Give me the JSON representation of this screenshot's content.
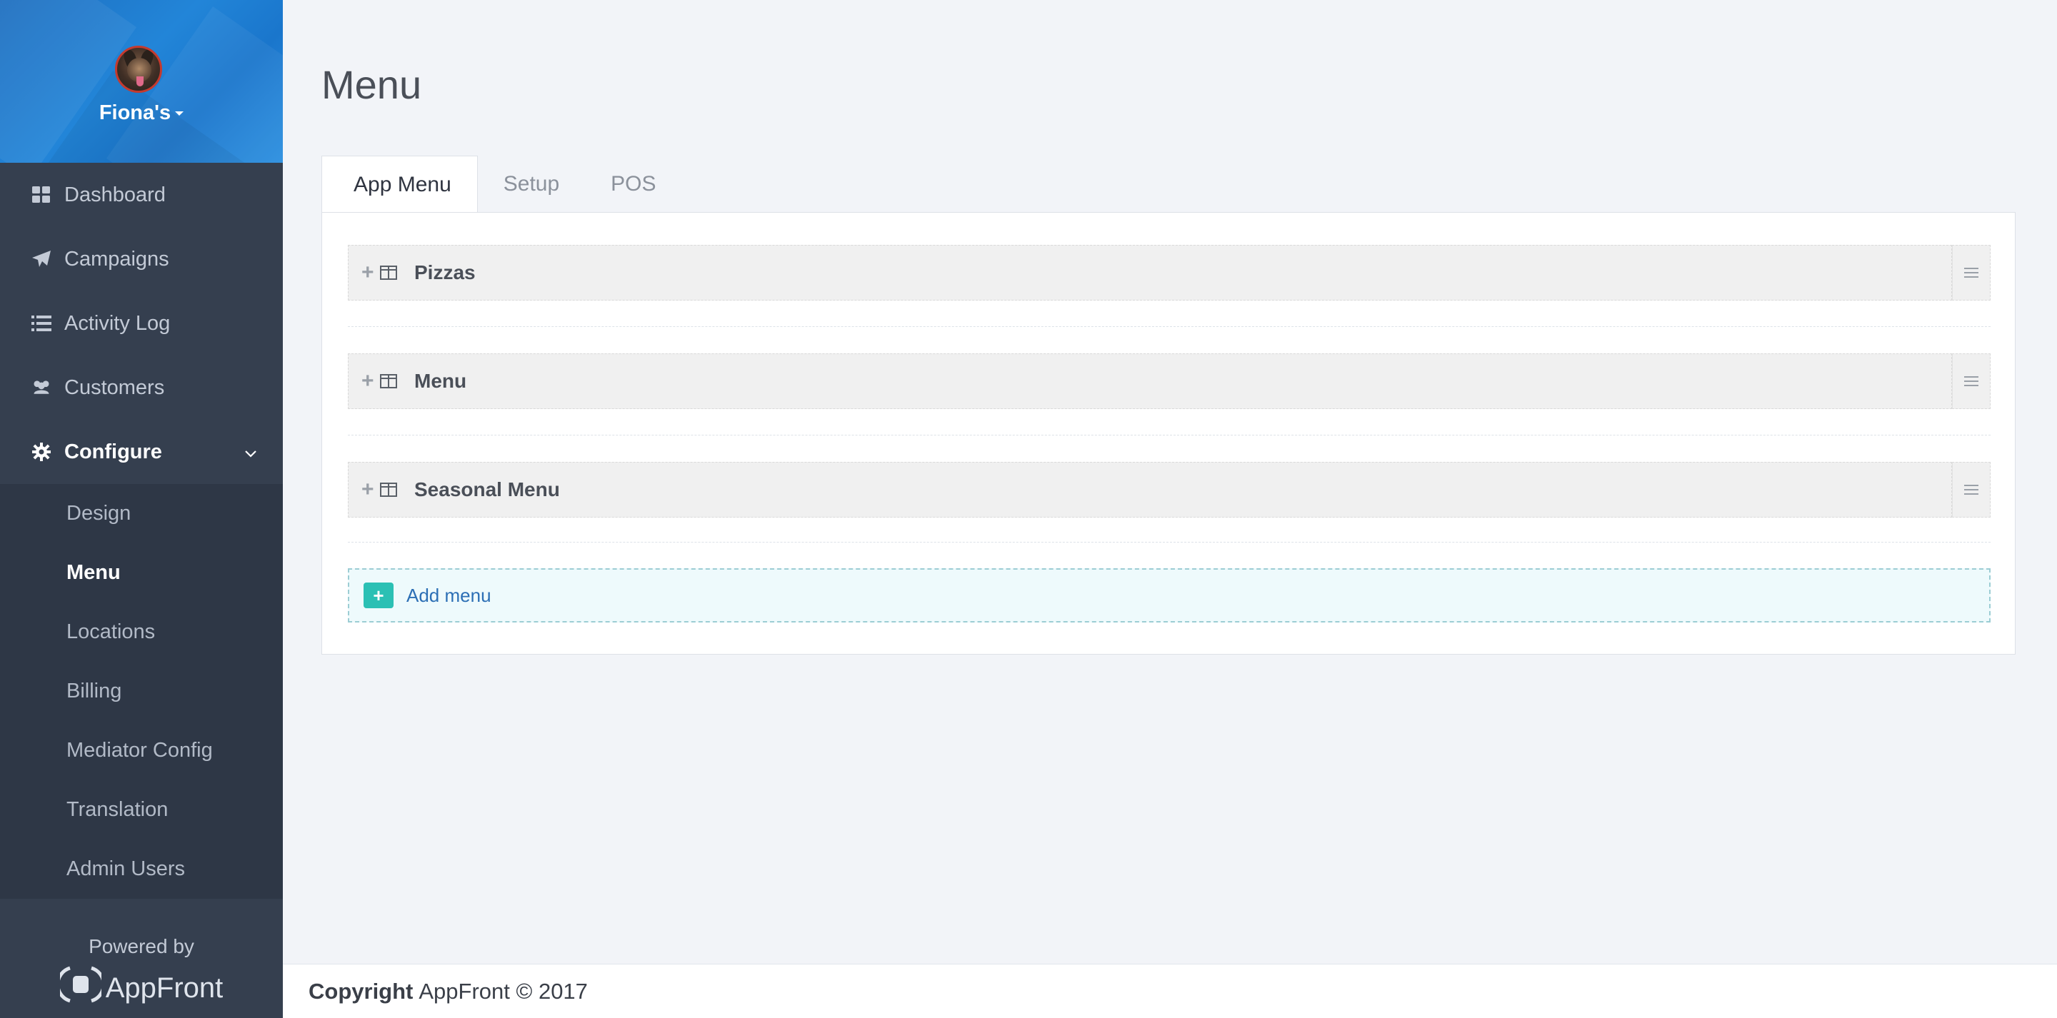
{
  "sidebar": {
    "brand": "Fiona's",
    "nav": [
      {
        "label": "Dashboard",
        "icon": "dashboard-icon"
      },
      {
        "label": "Campaigns",
        "icon": "paper-plane-icon"
      },
      {
        "label": "Activity Log",
        "icon": "list-icon"
      },
      {
        "label": "Customers",
        "icon": "users-icon"
      }
    ],
    "configure": {
      "label": "Configure",
      "icon": "gear-icon",
      "items": [
        {
          "label": "Design"
        },
        {
          "label": "Menu",
          "active": true
        },
        {
          "label": "Locations"
        },
        {
          "label": "Billing"
        },
        {
          "label": "Mediator Config"
        },
        {
          "label": "Translation"
        },
        {
          "label": "Admin Users"
        }
      ]
    },
    "footer": {
      "powered_by": "Powered by",
      "logo_text": "AppFront"
    }
  },
  "main": {
    "title": "Menu",
    "tabs": [
      {
        "label": "App Menu",
        "active": true
      },
      {
        "label": "Setup"
      },
      {
        "label": "POS"
      }
    ],
    "menus": [
      {
        "label": "Pizzas"
      },
      {
        "label": "Menu"
      },
      {
        "label": "Seasonal Menu"
      }
    ],
    "add_menu_label": "Add menu"
  },
  "footer": {
    "copyright_label": "Copyright",
    "copyright_text": "AppFront © 2017"
  },
  "colors": {
    "sidebar_bg": "#353f4f",
    "sidebar_header": "#1e78cc",
    "accent_teal": "#2bc0b4",
    "link_blue": "#2c6fb5"
  }
}
